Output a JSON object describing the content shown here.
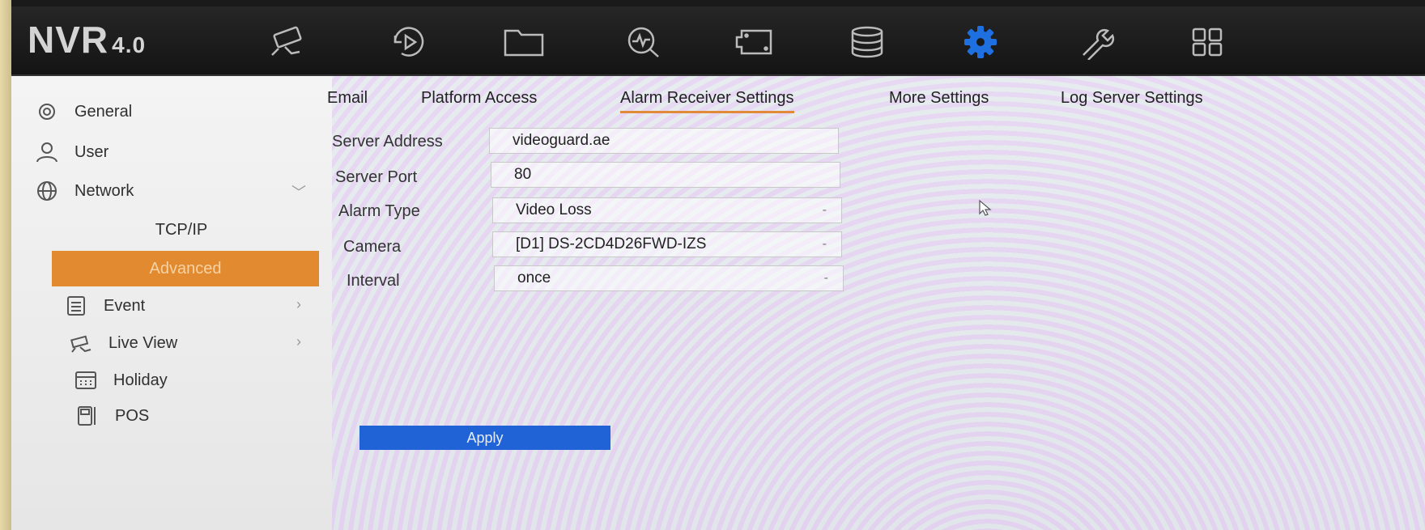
{
  "app": {
    "title": "NVR",
    "version": "4.0"
  },
  "toolbar": {
    "icons": [
      "camera-icon",
      "playback-icon",
      "folder-icon",
      "search-icon",
      "storage-device-icon",
      "database-icon",
      "settings-gear-icon",
      "maintenance-wrench-icon",
      "grid-menu-icon"
    ],
    "active_icon": "settings-gear-icon",
    "active_color": "#1e6fe0"
  },
  "sidebar": {
    "items": [
      {
        "label": "General",
        "icon": "gear-icon"
      },
      {
        "label": "User",
        "icon": "user-icon"
      },
      {
        "label": "Network",
        "icon": "globe-icon"
      },
      {
        "label": "TCP/IP"
      },
      {
        "label": "Advanced",
        "active": true
      },
      {
        "label": "Event",
        "icon": "event-list-icon"
      },
      {
        "label": "Live View",
        "icon": "camera-icon"
      },
      {
        "label": "Holiday",
        "icon": "calendar-icon"
      },
      {
        "label": "POS",
        "icon": "pos-terminal-icon"
      }
    ],
    "active_color": "#e28a2f"
  },
  "tabs": [
    {
      "label": "Email"
    },
    {
      "label": "Platform Access"
    },
    {
      "label": "Alarm Receiver Settings",
      "active": true
    },
    {
      "label": "More Settings"
    },
    {
      "label": "Log Server Settings"
    }
  ],
  "form": {
    "server_address": {
      "label": "Server Address",
      "value": "videoguard.ae"
    },
    "server_port": {
      "label": "Server Port",
      "value": "80"
    },
    "alarm_type": {
      "label": "Alarm Type",
      "value": "Video Loss"
    },
    "camera": {
      "label": "Camera",
      "value": "[D1] DS-2CD4D26FWD-IZS"
    },
    "interval": {
      "label": "Interval",
      "value": "once"
    }
  },
  "apply_label": "Apply",
  "apply_color": "#1f63d6"
}
